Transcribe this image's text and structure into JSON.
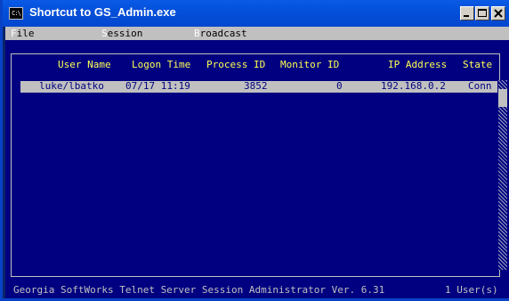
{
  "window": {
    "title": "Shortcut to GS_Admin.exe",
    "icon": "console-icon",
    "icon_text": "C:\\"
  },
  "menu": {
    "file": {
      "hotkey": "F",
      "rest": "ile"
    },
    "session": {
      "hotkey": "S",
      "rest": "ession"
    },
    "broadcast": {
      "hotkey": "B",
      "rest": "roadcast"
    }
  },
  "table": {
    "columns": [
      "User Name",
      "Logon Time",
      "Process ID",
      "Monitor ID",
      "IP Address",
      "State"
    ],
    "rows": [
      {
        "user": "luke/lbatko",
        "logon": "07/17 11:19",
        "process": "3852",
        "monitor": "0",
        "ip": "192.168.0.2",
        "state": "Conn",
        "selected": true
      }
    ]
  },
  "status": {
    "text": "Georgia SoftWorks Telnet Server Session Administrator Ver. 6.31",
    "users": "1 User(s)"
  },
  "colors": {
    "console_bg": "#000080",
    "header_text": "#ffff55",
    "selection": "#c0c0c0",
    "titlebar": "#0450da"
  }
}
